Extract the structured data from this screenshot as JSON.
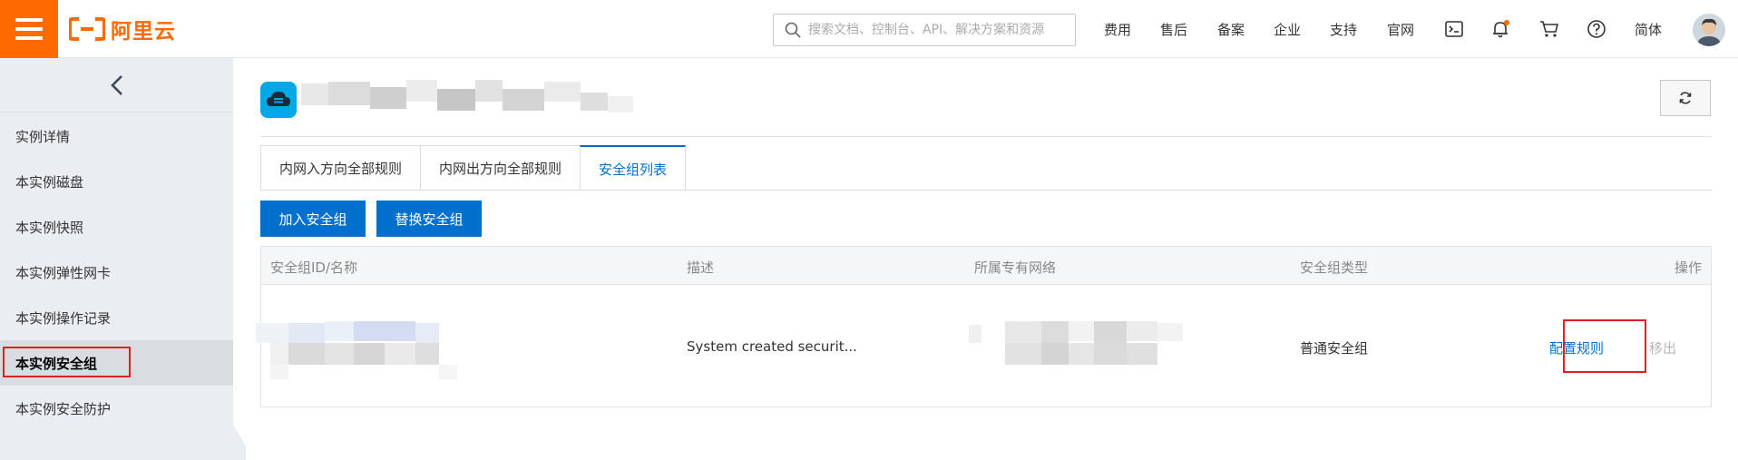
{
  "header": {
    "logo_text": "阿里云",
    "brand_color": "#ff6a00",
    "search": {
      "placeholder": "搜索文档、控制台、API、解决方案和资源"
    },
    "nav": {
      "fees": "费用",
      "after_sales": "售后",
      "icp": "备案",
      "enterprise": "企业",
      "support": "支持",
      "official_site": "官网",
      "language": "简体"
    },
    "icons": [
      "menu-icon",
      "search-icon",
      "terminal-icon",
      "bell-icon",
      "cart-icon",
      "help-icon",
      "avatar"
    ]
  },
  "sidebar": {
    "items": [
      {
        "label": "实例详情"
      },
      {
        "label": "本实例磁盘"
      },
      {
        "label": "本实例快照"
      },
      {
        "label": "本实例弹性网卡"
      },
      {
        "label": "本实例操作记录"
      },
      {
        "label": "本实例安全组",
        "active": true
      },
      {
        "label": "本实例安全防护"
      }
    ]
  },
  "main": {
    "tabs": [
      {
        "label": "内网入方向全部规则"
      },
      {
        "label": "内网出方向全部规则"
      },
      {
        "label": "安全组列表",
        "active": true
      }
    ],
    "buttons": {
      "join": "加入安全组",
      "replace": "替换安全组"
    },
    "table": {
      "headers": {
        "id_name": "安全组ID/名称",
        "description": "描述",
        "vpc": "所属专有网络",
        "type": "安全组类型",
        "actions": "操作"
      },
      "rows": [
        {
          "description": "System created securit...",
          "type": "普通安全组",
          "configure": "配置规则",
          "remove": "移出"
        }
      ]
    },
    "accent_color": "#0070cc",
    "highlight_color": "#e02020"
  }
}
